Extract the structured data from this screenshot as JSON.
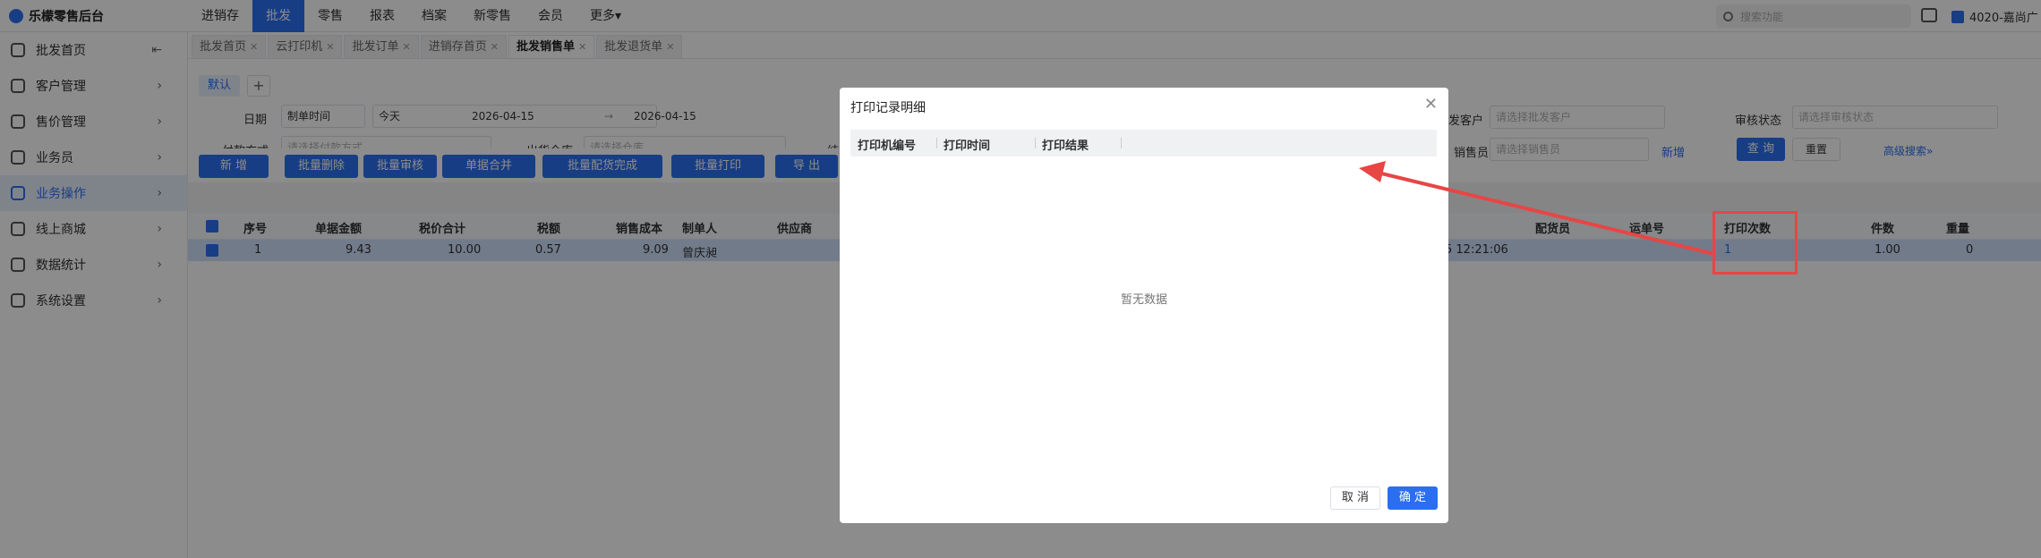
{
  "app": {
    "logo": "乐檬零售后台"
  },
  "nav": [
    "进销存",
    "批发",
    "零售",
    "报表",
    "档案",
    "新零售",
    "会员",
    "更多▾"
  ],
  "search": {
    "placeholder": "搜索功能"
  },
  "store": "4020-嘉尚广",
  "sidebar": [
    {
      "label": "批发首页"
    },
    {
      "label": "客户管理"
    },
    {
      "label": "售价管理"
    },
    {
      "label": "业务员"
    },
    {
      "label": "业务操作"
    },
    {
      "label": "线上商城"
    },
    {
      "label": "数据统计"
    },
    {
      "label": "系统设置"
    }
  ],
  "tabs": [
    "批发首页",
    "云打印机",
    "批发订单",
    "进销存首页",
    "批发销售单",
    "批发退货单"
  ],
  "filters": {
    "default_chip": "默认",
    "add": "+",
    "date_label": "日期",
    "date_type": "制单时间",
    "date_preset": "今天",
    "date_start": "2026-04-15",
    "date_arrow": "→",
    "date_end": "2026-04-15",
    "pay_label": "付款方式",
    "pay_ph": "请选择付款方式",
    "wh_label": "出货仓库",
    "wh_ph": "请选择仓库",
    "settle_label": "结",
    "cust_label": "发客户",
    "cust_ph": "请选择批发客户",
    "audit_label": "审核状态",
    "audit_ph": "请选择审核状态",
    "sales_label": "销售员",
    "sales_ph": "请选择销售员",
    "new_link": "新增",
    "query": "查 询",
    "reset": "重置",
    "advanced": "高级搜索»"
  },
  "buttons": [
    "新 增",
    "批量删除",
    "批量审核",
    "单据合并",
    "批量配货完成",
    "批量打印",
    "导 出"
  ],
  "table": {
    "headers": [
      "序号",
      "单据金额",
      "税价合计",
      "税额",
      "销售成本",
      "制单人",
      "供应商",
      "配货员",
      "运单号",
      "打印次数",
      "件数",
      "重量"
    ],
    "row": [
      "1",
      "9.43",
      "10.00",
      "0.57",
      "9.09",
      "曾庆昶",
      "5 12:21:06",
      "1",
      "1.00",
      "0"
    ]
  },
  "modal": {
    "title": "打印记录明细",
    "cols": [
      "打印机编号",
      "打印时间",
      "打印结果"
    ],
    "empty": "暂无数据",
    "cancel": "取 消",
    "ok": "确 定"
  },
  "colors": {
    "primary": "#2a6ff0",
    "annotation": "#e84545"
  }
}
